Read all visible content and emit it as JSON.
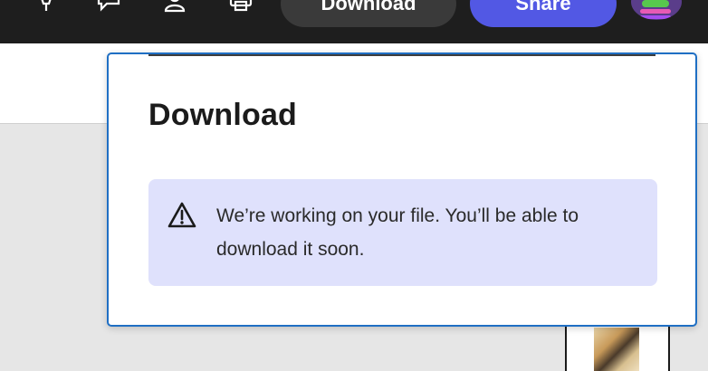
{
  "toolbar": {
    "icons": [
      "pen-icon",
      "comment-icon",
      "user-icon",
      "print-icon"
    ],
    "download_label": "Download",
    "share_label": "Share"
  },
  "dialog": {
    "title": "Download",
    "alert": {
      "icon": "warning-icon",
      "message": "We’re working on your file. You’ll be able to download it soon."
    }
  },
  "colors": {
    "topbar": "#1e1e1e",
    "share_button": "#5258e4",
    "dialog_border": "#1f6fc4",
    "alert_background": "#dfe1fc"
  }
}
